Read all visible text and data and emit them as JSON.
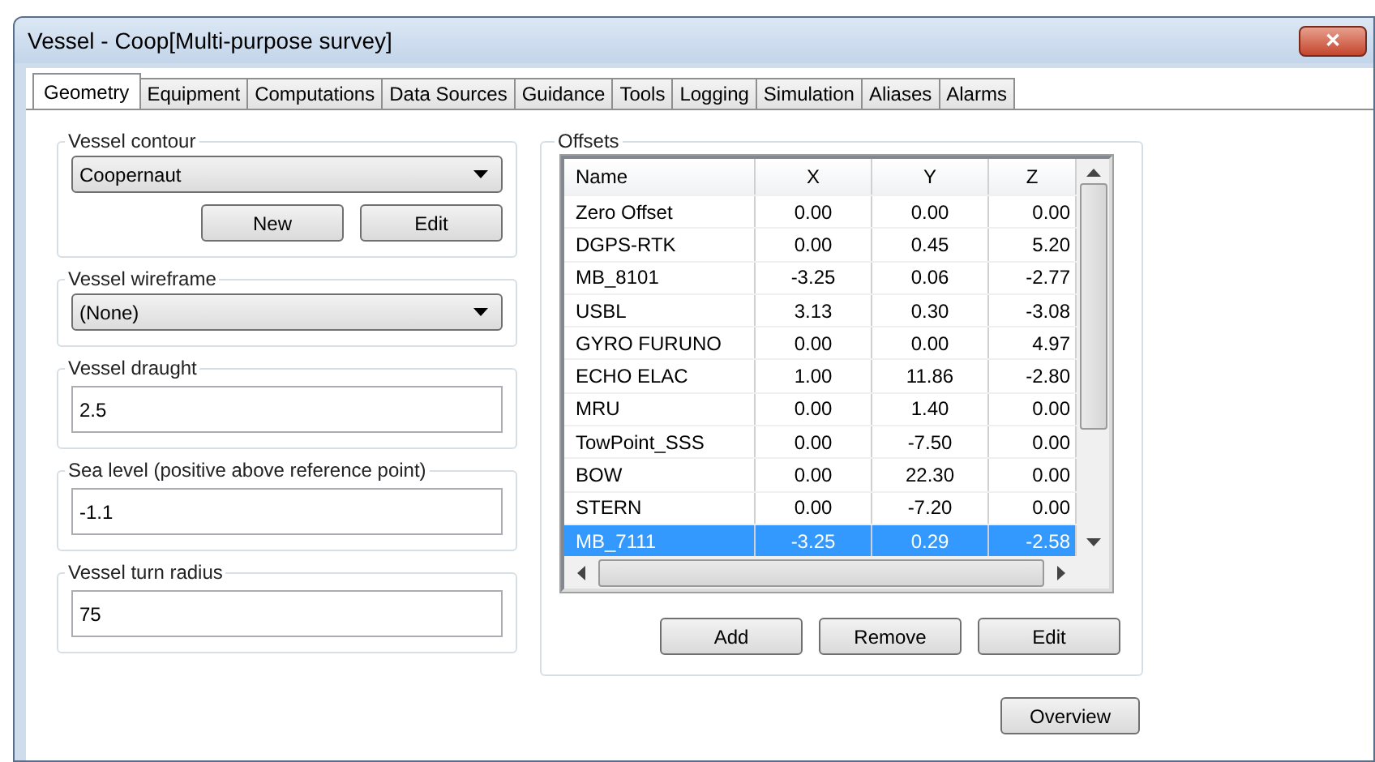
{
  "window": {
    "title": "Vessel - Coop[Multi-purpose survey]",
    "close_glyph": "✕"
  },
  "tabs": [
    {
      "label": "Geometry",
      "selected": true
    },
    {
      "label": "Equipment",
      "selected": false
    },
    {
      "label": "Computations",
      "selected": false
    },
    {
      "label": "Data Sources",
      "selected": false
    },
    {
      "label": "Guidance",
      "selected": false
    },
    {
      "label": "Tools",
      "selected": false
    },
    {
      "label": "Logging",
      "selected": false
    },
    {
      "label": "Simulation",
      "selected": false
    },
    {
      "label": "Aliases",
      "selected": false
    },
    {
      "label": "Alarms",
      "selected": false
    }
  ],
  "groups": [
    {
      "kind": "dropdown",
      "title": "Vessel contour",
      "value": "Coopernaut",
      "buttons": [
        "New",
        "Edit"
      ]
    },
    {
      "kind": "dropdown",
      "title": "Vessel wireframe",
      "value": "(None)"
    },
    {
      "kind": "field",
      "title": "Vessel draught",
      "value": "2.5"
    },
    {
      "kind": "field",
      "title": "Sea level (positive above reference point)",
      "value": "-1.1"
    },
    {
      "kind": "field",
      "title": "Vessel turn radius",
      "value": "75"
    }
  ],
  "offsets": {
    "title": "Offsets",
    "columns": [
      "Name",
      "X",
      "Y",
      "Z"
    ],
    "rows": [
      {
        "cells": [
          "Zero Offset",
          "0.00",
          "0.00",
          "0.00"
        ],
        "selected": false
      },
      {
        "cells": [
          "DGPS-RTK",
          "0.00",
          "0.45",
          "5.20"
        ],
        "selected": false
      },
      {
        "cells": [
          "MB_8101",
          "-3.25",
          "0.06",
          "-2.77"
        ],
        "selected": false
      },
      {
        "cells": [
          "USBL",
          "3.13",
          "0.30",
          "-3.08"
        ],
        "selected": false
      },
      {
        "cells": [
          "GYRO FURUNO",
          "0.00",
          "0.00",
          "4.97"
        ],
        "selected": false
      },
      {
        "cells": [
          "ECHO ELAC",
          "1.00",
          "11.86",
          "-2.80"
        ],
        "selected": false
      },
      {
        "cells": [
          "MRU",
          "0.00",
          "1.40",
          "0.00"
        ],
        "selected": false
      },
      {
        "cells": [
          "TowPoint_SSS",
          "0.00",
          "-7.50",
          "0.00"
        ],
        "selected": false
      },
      {
        "cells": [
          "BOW",
          "0.00",
          "22.30",
          "0.00"
        ],
        "selected": false
      },
      {
        "cells": [
          "STERN",
          "0.00",
          "-7.20",
          "0.00"
        ],
        "selected": false
      },
      {
        "cells": [
          "MB_7111",
          "-3.25",
          "0.29",
          "-2.58"
        ],
        "selected": true
      }
    ],
    "buttons": [
      "Add",
      "Remove",
      "Edit"
    ]
  },
  "overview_button": "Overview"
}
